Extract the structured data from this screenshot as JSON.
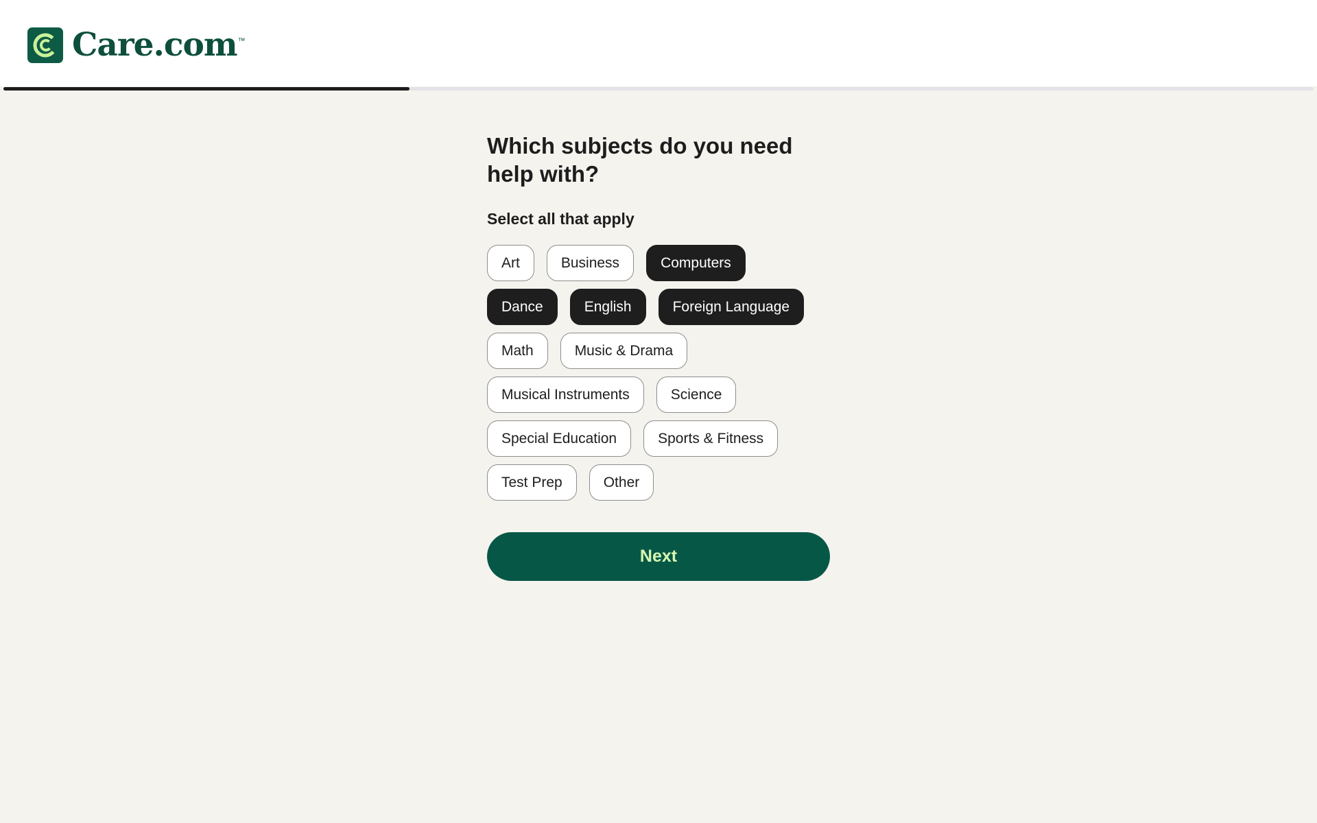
{
  "brand": {
    "name": "Care.com",
    "trademark": "™"
  },
  "progress": {
    "fraction": 0.31
  },
  "question": {
    "title": "Which subjects do you need help with?",
    "hint": "Select all that apply"
  },
  "subjects": [
    [
      {
        "label": "Art",
        "selected": false
      },
      {
        "label": "Business",
        "selected": false
      },
      {
        "label": "Computers",
        "selected": true
      }
    ],
    [
      {
        "label": "Dance",
        "selected": true
      },
      {
        "label": "English",
        "selected": true
      },
      {
        "label": "Foreign Language",
        "selected": true
      }
    ],
    [
      {
        "label": "Math",
        "selected": false
      },
      {
        "label": "Music & Drama",
        "selected": false
      }
    ],
    [
      {
        "label": "Musical Instruments",
        "selected": false
      },
      {
        "label": "Science",
        "selected": false
      }
    ],
    [
      {
        "label": "Special Education",
        "selected": false
      },
      {
        "label": "Sports & Fitness",
        "selected": false
      }
    ],
    [
      {
        "label": "Test Prep",
        "selected": false
      },
      {
        "label": "Other",
        "selected": false
      }
    ]
  ],
  "actions": {
    "next_label": "Next"
  },
  "colors": {
    "brand_green": "#0d5b45",
    "button_green": "#075747",
    "button_text": "#d7f7b0",
    "selected_chip": "#1e1e1e",
    "page_background": "#f5f3ee"
  }
}
